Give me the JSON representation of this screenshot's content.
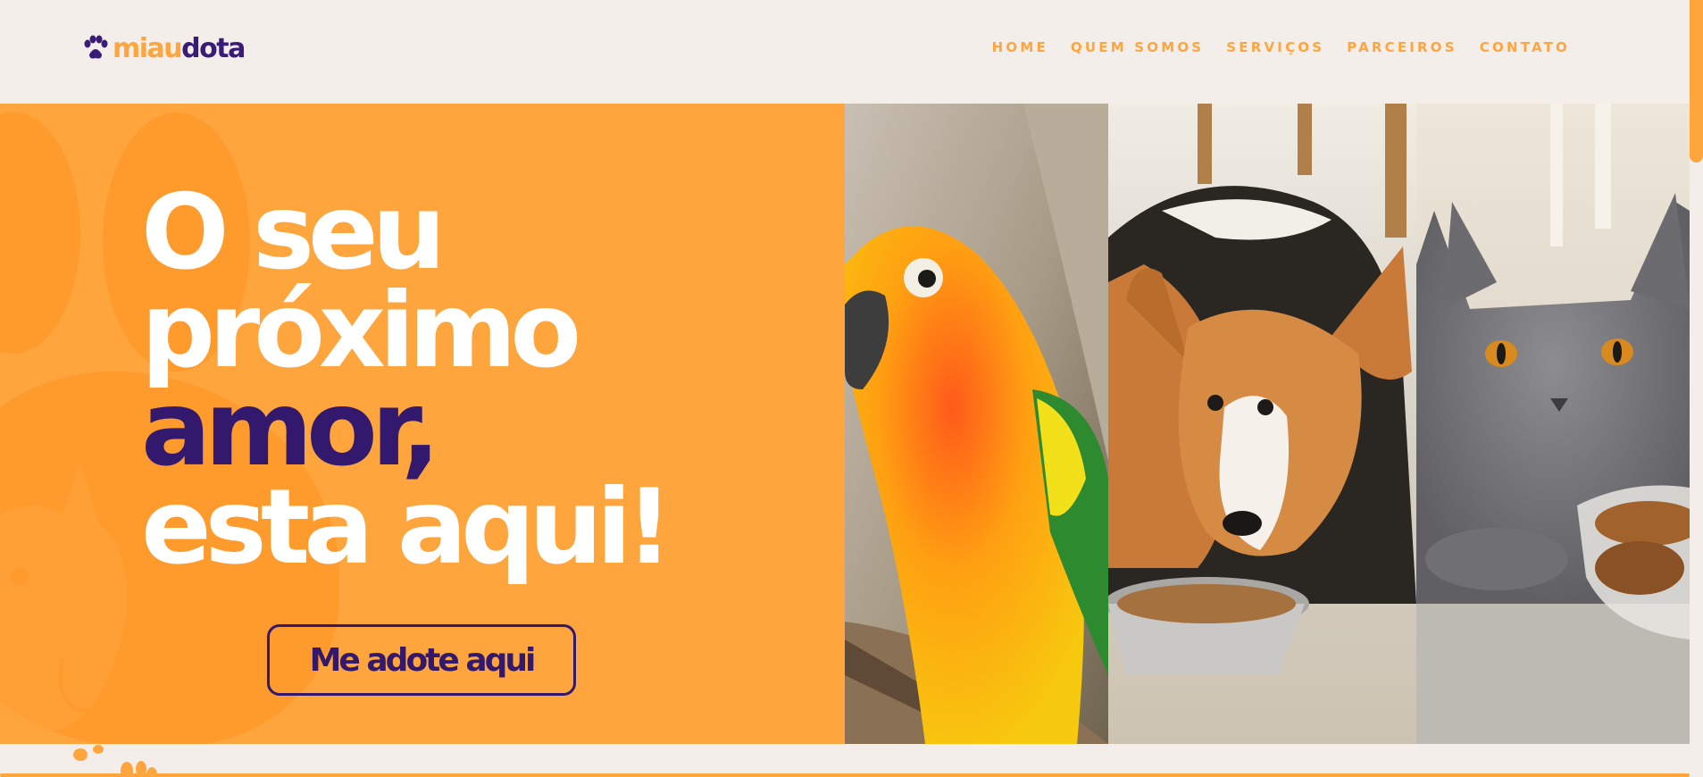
{
  "brand": {
    "part1": "miau",
    "part2": "dota"
  },
  "nav": [
    {
      "label": "HOME"
    },
    {
      "label": "QUEM SOMOS"
    },
    {
      "label": "SERVIÇOS"
    },
    {
      "label": "PARCEIROS"
    },
    {
      "label": "CONTATO"
    }
  ],
  "hero": {
    "line1": "O seu",
    "line2": "próximo",
    "line3": "amor,",
    "line4": "esta aqui!",
    "cta": "Me adote aqui"
  },
  "photos": [
    {
      "name": "parrot-photo"
    },
    {
      "name": "dog-photo"
    },
    {
      "name": "cat-photo"
    }
  ],
  "colors": {
    "orange": "#ffa53e",
    "purple": "#33196e",
    "background": "#f3eee9"
  }
}
